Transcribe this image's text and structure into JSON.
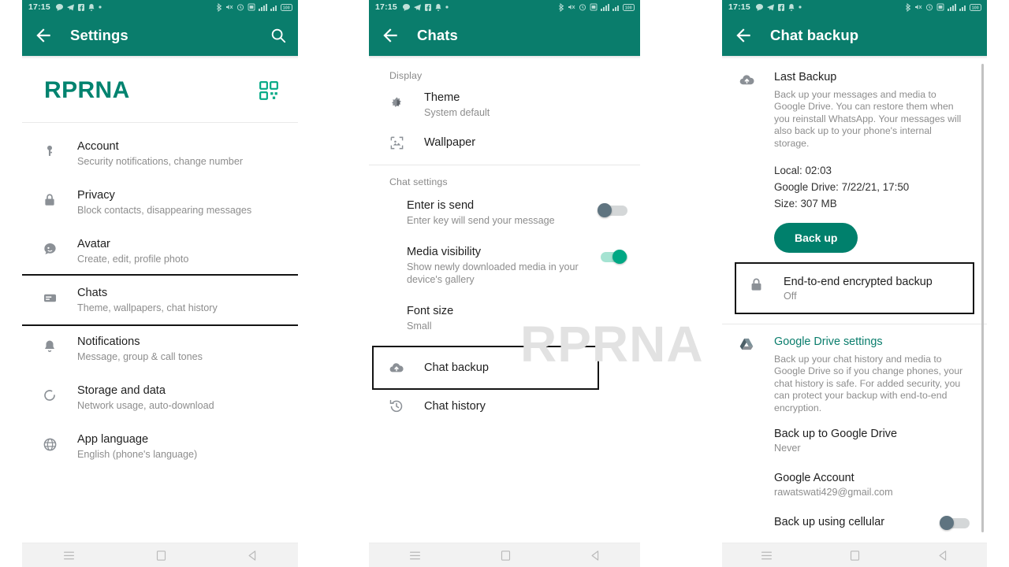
{
  "colors": {
    "brand_green": "#0a7d6c",
    "accent_green": "#00a884",
    "name_green": "#00836f",
    "toggle_off": "#5f7480",
    "highlight_box": "#141414",
    "watermark": "#e2e2e2"
  },
  "status_bar": {
    "time": "17:15",
    "left_icons": [
      "chat-bubble-icon",
      "telegram-icon",
      "facebook-icon",
      "bell-icon",
      "dot-icon"
    ],
    "right_icons": [
      "bluetooth-icon",
      "mute-icon",
      "alarm-icon",
      "sim-icon",
      "signal-1-icon",
      "signal-2-icon",
      "battery-100-icon"
    ]
  },
  "nav_bar": {
    "recents": "recents-icon",
    "home": "home-icon",
    "back": "back-icon"
  },
  "watermark": "RPRNA",
  "panel1": {
    "appbar": {
      "back_icon": "back-arrow-icon",
      "title": "Settings",
      "search_icon": "search-icon"
    },
    "profile": {
      "name": "RPRNA",
      "qr_icon": "qr-code-icon"
    },
    "items": [
      {
        "icon": "key-icon",
        "title": "Account",
        "subtitle": "Security notifications, change number",
        "highlighted": false
      },
      {
        "icon": "lock-icon",
        "title": "Privacy",
        "subtitle": "Block contacts, disappearing messages",
        "highlighted": false
      },
      {
        "icon": "avatar-icon",
        "title": "Avatar",
        "subtitle": "Create, edit, profile photo",
        "highlighted": false
      },
      {
        "icon": "chats-icon",
        "title": "Chats",
        "subtitle": "Theme, wallpapers, chat history",
        "highlighted": true
      },
      {
        "icon": "bell-icon",
        "title": "Notifications",
        "subtitle": "Message, group & call tones",
        "highlighted": false
      },
      {
        "icon": "storage-icon",
        "title": "Storage and data",
        "subtitle": "Network usage, auto-download",
        "highlighted": false
      },
      {
        "icon": "globe-icon",
        "title": "App language",
        "subtitle": "English (phone's language)",
        "highlighted": false
      }
    ]
  },
  "panel2": {
    "appbar": {
      "back_icon": "back-arrow-icon",
      "title": "Chats"
    },
    "sections": [
      {
        "label": "Display",
        "items": [
          {
            "icon": "theme-icon",
            "title": "Theme",
            "subtitle": "System default",
            "toggle": null,
            "highlighted": false
          },
          {
            "icon": "wallpaper-icon",
            "title": "Wallpaper",
            "subtitle": "",
            "toggle": null,
            "highlighted": false
          }
        ]
      },
      {
        "label": "Chat settings",
        "items": [
          {
            "icon": "",
            "title": "Enter is send",
            "subtitle": "Enter key will send your message",
            "toggle": "off",
            "highlighted": false
          },
          {
            "icon": "",
            "title": "Media visibility",
            "subtitle": "Show newly downloaded media in your device's gallery",
            "toggle": "on",
            "highlighted": false
          },
          {
            "icon": "",
            "title": "Font size",
            "subtitle": "Small",
            "toggle": null,
            "highlighted": false
          },
          {
            "icon": "cloud-upload-icon",
            "title": "Chat backup",
            "subtitle": "",
            "toggle": null,
            "highlighted": true
          },
          {
            "icon": "history-icon",
            "title": "Chat history",
            "subtitle": "",
            "toggle": null,
            "highlighted": false
          }
        ]
      }
    ]
  },
  "panel3": {
    "appbar": {
      "back_icon": "back-arrow-icon",
      "title": "Chat backup"
    },
    "last_backup": {
      "icon": "cloud-upload-icon",
      "title": "Last Backup",
      "description": "Back up your messages and media to Google Drive. You can restore them when you reinstall WhatsApp. Your messages will also back up to your phone's internal storage.",
      "local_label": "Local: 02:03",
      "drive_label": "Google Drive: 7/22/21, 17:50",
      "size_label": "Size: 307 MB",
      "button_label": "Back up"
    },
    "e2e": {
      "icon": "lock-icon",
      "title": "End-to-end encrypted backup",
      "subtitle": "Off",
      "highlighted": true
    },
    "google_drive": {
      "icon": "google-drive-icon",
      "title": "Google Drive settings",
      "description": "Back up your chat history and media to Google Drive so if you change phones, your chat history is safe. For added security, you can protect your backup with end-to-end encryption."
    },
    "options": [
      {
        "title": "Back up to Google Drive",
        "subtitle": "Never",
        "toggle": null
      },
      {
        "title": "Google Account",
        "subtitle": "rawatswati429@gmail.com",
        "toggle": null
      },
      {
        "title": "Back up using cellular",
        "subtitle": "",
        "toggle": "off"
      }
    ]
  }
}
